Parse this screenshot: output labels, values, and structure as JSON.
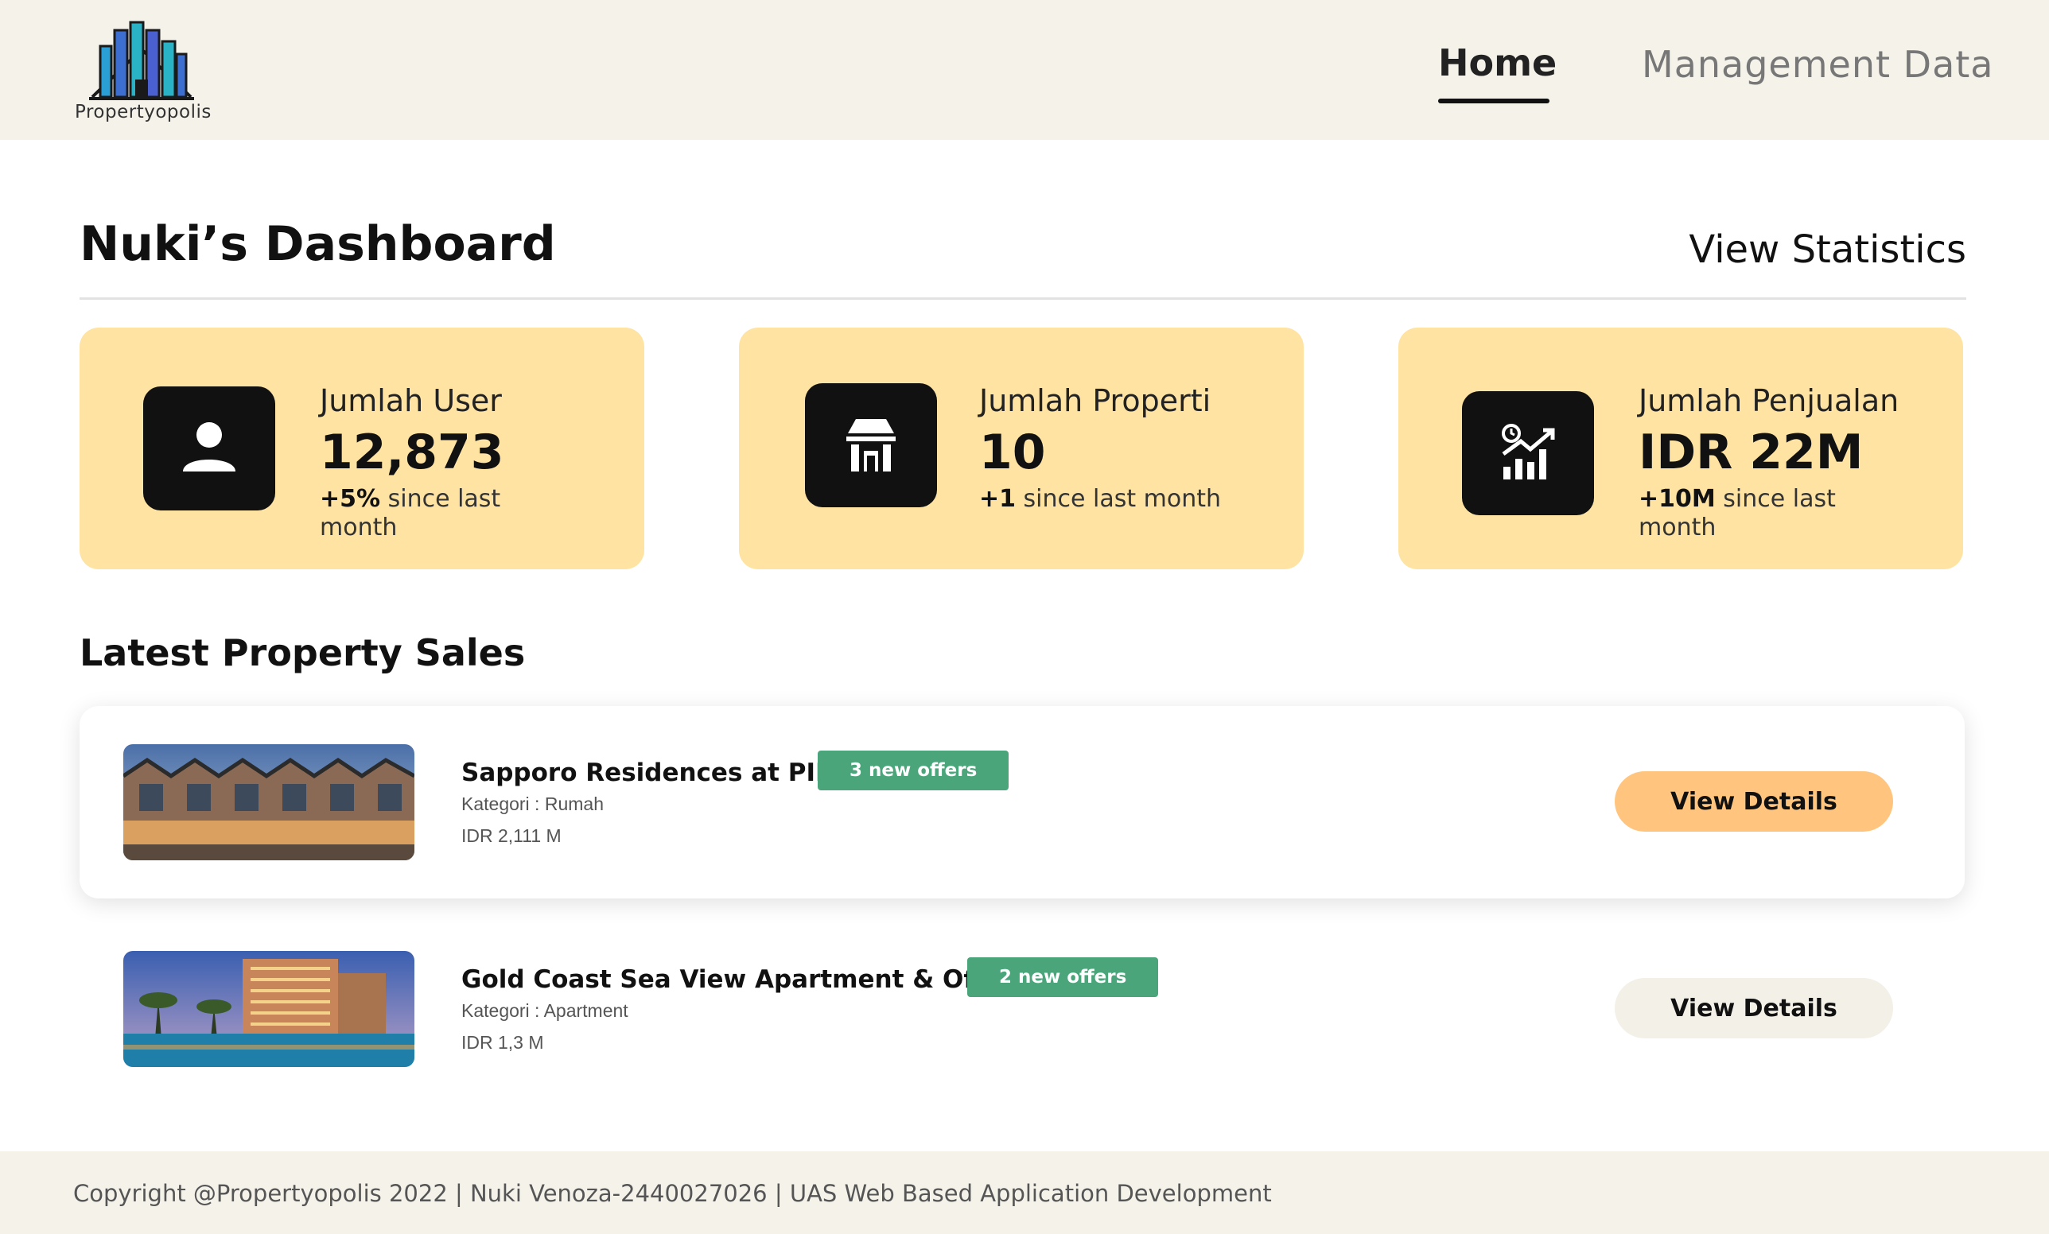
{
  "brand": {
    "name": "Propertyopolis"
  },
  "nav": {
    "home": "Home",
    "management": "Management Data"
  },
  "header": {
    "title": "Nuki’s Dashboard",
    "view_statistics": "View Statistics"
  },
  "stats": [
    {
      "label": "Jumlah User",
      "value": "12,873",
      "change": "+5%",
      "change_suffix": " since last month",
      "icon": "user-icon"
    },
    {
      "label": "Jumlah Properti",
      "value": "10",
      "change": "+1",
      "change_suffix": " since last month",
      "icon": "store-icon"
    },
    {
      "label": "Jumlah Penjualan",
      "value": "IDR 22M",
      "change": "+10M",
      "change_suffix": " since last month",
      "icon": "sales-chart-icon"
    }
  ],
  "latest": {
    "title": "Latest Property Sales",
    "items": [
      {
        "name": "Sapporo Residences at PIK2",
        "badge": "3 new offers",
        "category": "Kategori : Rumah",
        "price": "IDR 2,111 M",
        "button": "View Details"
      },
      {
        "name": "Gold Coast Sea View Apartment & Office",
        "badge": "2 new offers",
        "category": "Kategori : Apartment",
        "price": "IDR 1,3 M",
        "button": "View Details"
      }
    ]
  },
  "footer": {
    "text": "Copyright @Propertyopolis 2022  | Nuki Venoza-2440027026 | UAS Web Based Application Development"
  },
  "colors": {
    "card": "#ffe3a3",
    "badge": "#4aa57a",
    "button_primary": "#ffc57e",
    "button_secondary": "#f3f0e8",
    "nav_bg": "#f5f2ea"
  }
}
